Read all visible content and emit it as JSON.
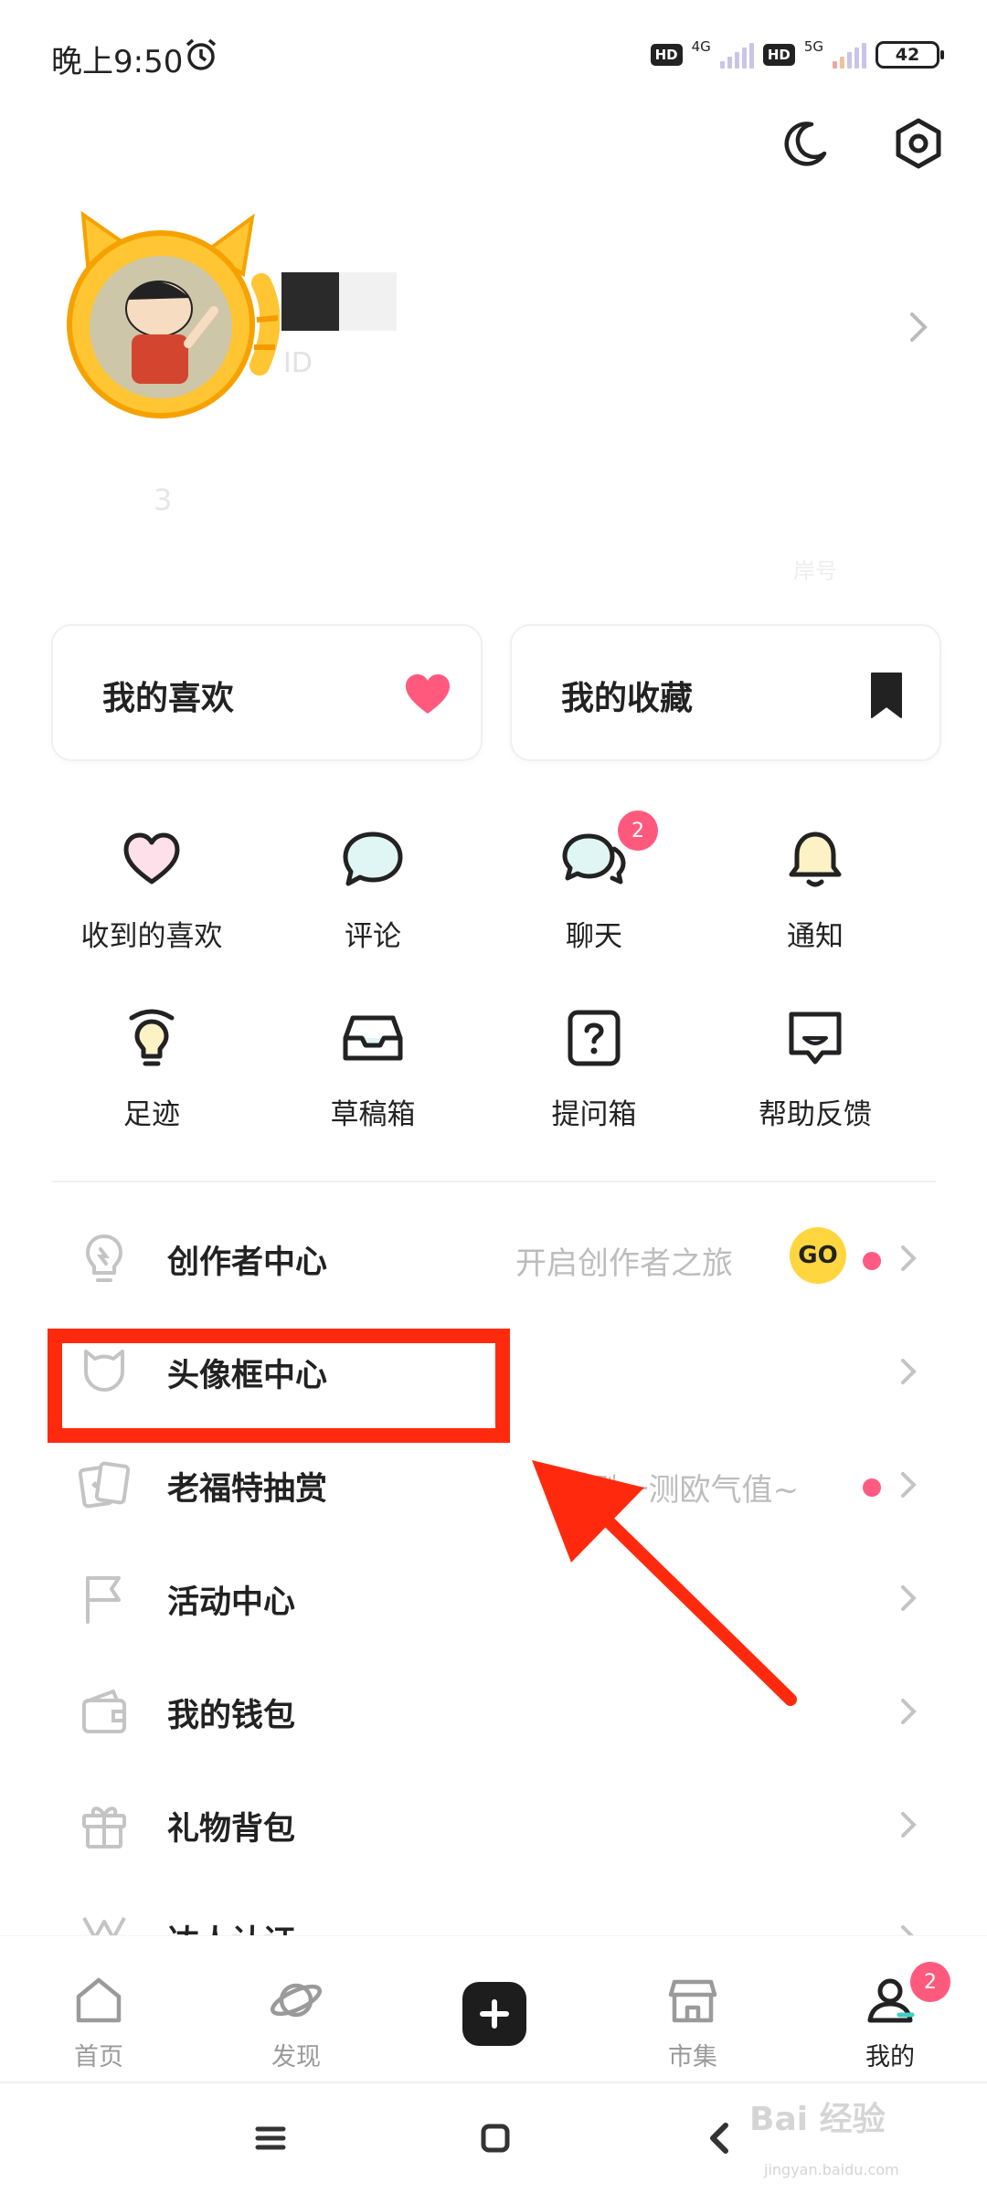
{
  "status_bar": {
    "time": "晚上9:50",
    "hd_label": "HD",
    "network1": "4G",
    "network2": "5G",
    "battery": "42"
  },
  "profile": {
    "id_label": "ID",
    "faint_text_a": "3",
    "faint_text_b": "岸号"
  },
  "cards": {
    "likes": "我的喜欢",
    "favorites": "我的收藏"
  },
  "grid": [
    {
      "label": "收到的喜欢"
    },
    {
      "label": "评论"
    },
    {
      "label": "聊天",
      "badge": "2"
    },
    {
      "label": "通知"
    },
    {
      "label": "足迹"
    },
    {
      "label": "草稿箱"
    },
    {
      "label": "提问箱"
    },
    {
      "label": "帮助反馈"
    }
  ],
  "list": [
    {
      "label": "创作者中心",
      "hint": "开启创作者之旅",
      "go": "GO"
    },
    {
      "label": "头像框中心"
    },
    {
      "label": "老福特抽赏",
      "hint": "测一测欧气值~"
    },
    {
      "label": "活动中心"
    },
    {
      "label": "我的钱包"
    },
    {
      "label": "礼物背包"
    },
    {
      "label": "达人认证"
    }
  ],
  "bottom_nav": [
    {
      "label": "首页"
    },
    {
      "label": "发现"
    },
    {
      "label": "市集"
    },
    {
      "label": "我的",
      "badge": "2"
    }
  ],
  "watermark": {
    "text": "Bai 经验",
    "sub": "jingyan.baidu.com"
  },
  "colors": {
    "accent_pink": "#ff5a7e",
    "highlight_red": "#ff2a0e",
    "go_yellow": "#ffd63f"
  }
}
